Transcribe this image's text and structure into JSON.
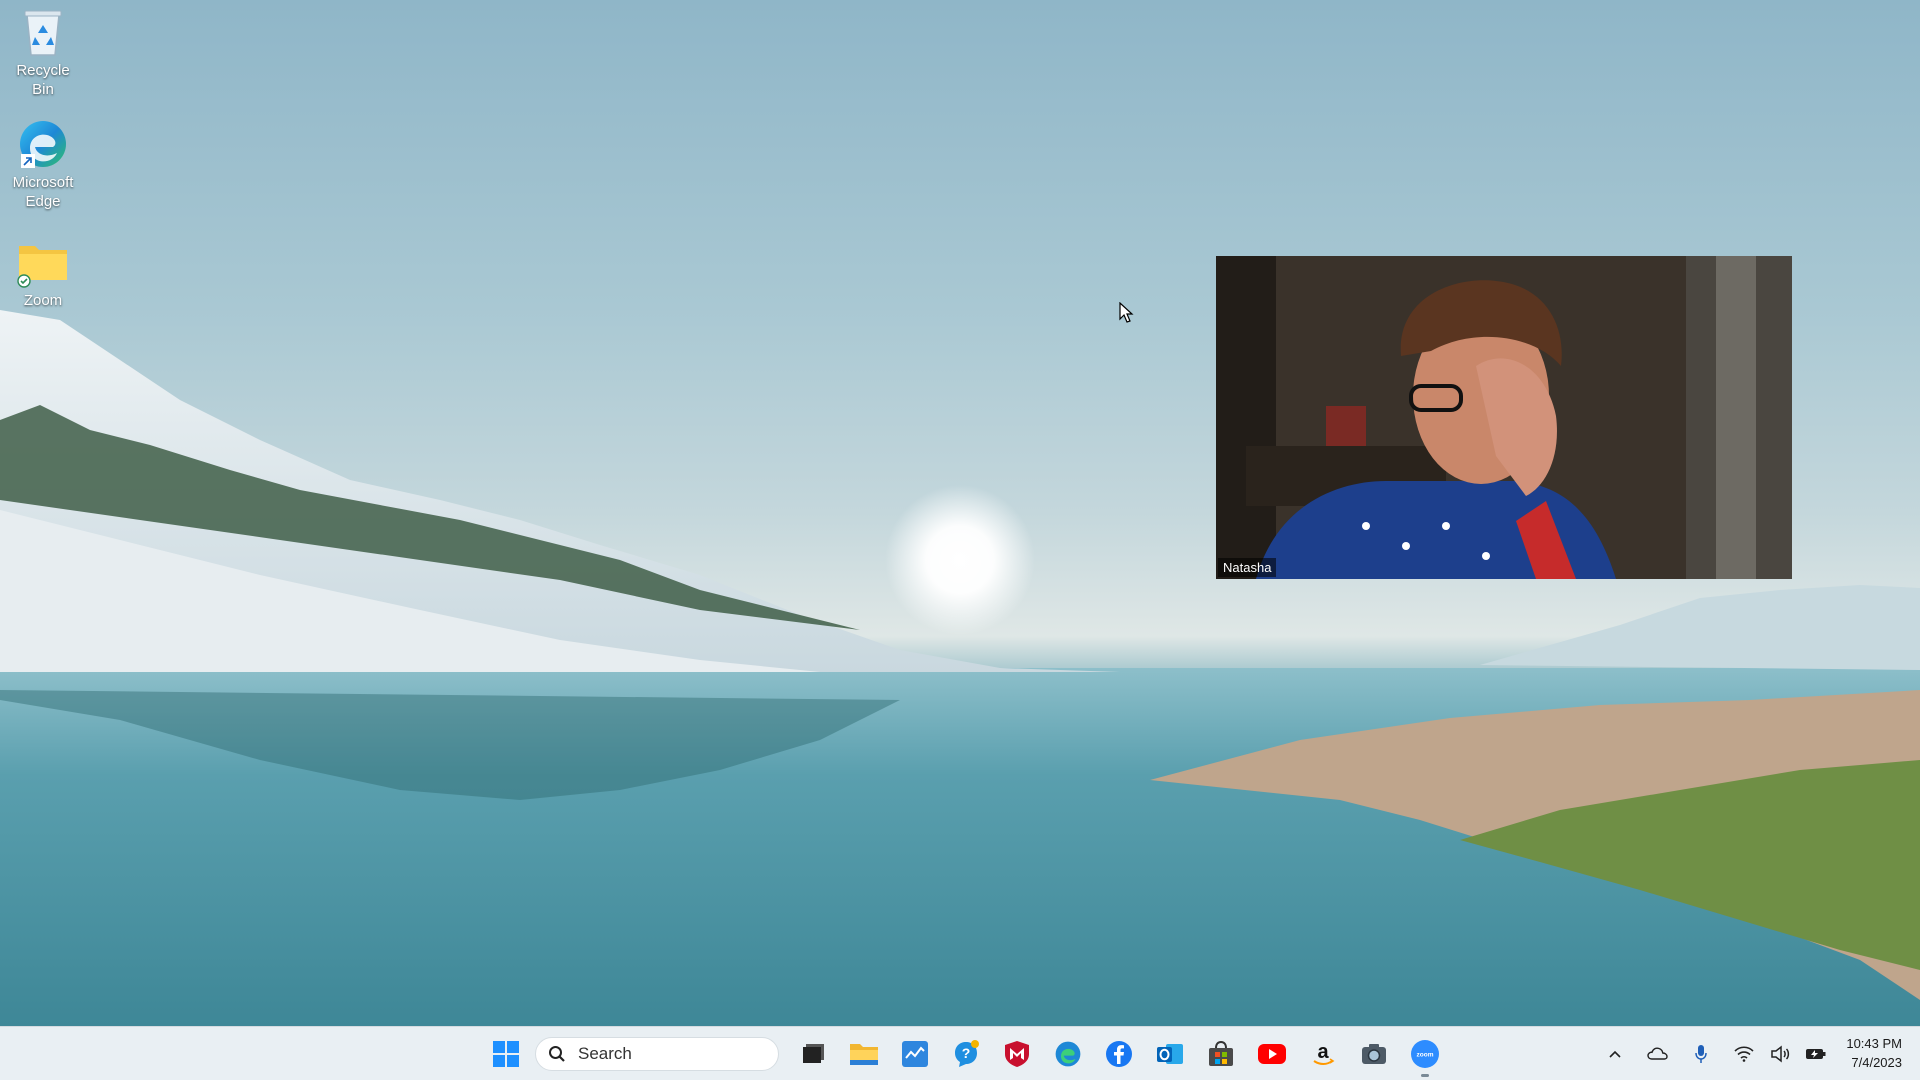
{
  "desktop": {
    "icons": [
      {
        "label": "Recycle Bin",
        "icon": "recycle-bin-icon"
      },
      {
        "label": "Microsoft Edge",
        "icon": "edge-icon"
      },
      {
        "label": "Zoom",
        "icon": "folder-icon"
      }
    ]
  },
  "zoom_video": {
    "participant_name": "Natasha"
  },
  "taskbar": {
    "search_placeholder": "Search",
    "pinned": [
      "windows-start-icon",
      "task-view-icon",
      "file-explorer-icon",
      "mcafee-myapp-icon",
      "get-help-icon",
      "mcafee-icon",
      "edge-icon",
      "facebook-icon",
      "outlook-icon",
      "microsoft-store-icon",
      "youtube-icon",
      "amazon-icon",
      "camera-icon",
      "zoom-icon"
    ],
    "tray": {
      "time": "10:43 PM",
      "date": "7/4/2023"
    }
  },
  "colors": {
    "taskbar_bg": "#e9eff3",
    "accent_blue": "#0078d4",
    "zoom_blue": "#2d8cff"
  }
}
